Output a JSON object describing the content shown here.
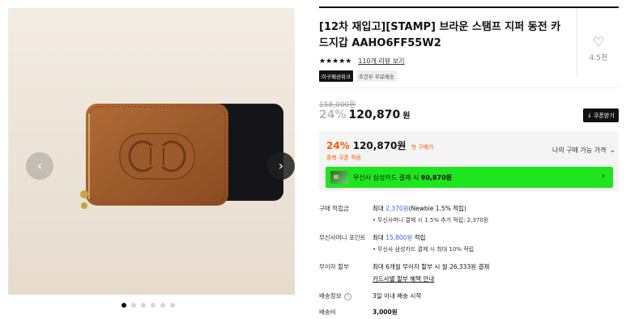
{
  "gallery": {
    "prev_icon": "chevron-left-icon",
    "next_icon": "chevron-right-icon",
    "prev_glyph": "‹",
    "next_glyph": "›",
    "slide_count": 6,
    "active_slide": 1
  },
  "product": {
    "title": "[12차 재입고][STAMP] 브라운 스탬프 지퍼 동전 카드지갑 AAHO6FF55W2",
    "stars": "★★★★★",
    "review_link": "110개 리뷰 보기",
    "badge_1": "이구패션위크",
    "badge_2": "조건부 무료배송"
  },
  "like": {
    "icon": "heart-icon",
    "glyph": "♡",
    "count": "4.5천"
  },
  "price": {
    "original": "158,000원",
    "discount": "24%",
    "sale": "120,870",
    "sale_unit": "원",
    "coupon_button": "쿠폰받기",
    "coupon_glyph": "↓"
  },
  "price_box": {
    "discount": "24%",
    "sale": "120,870원",
    "first_purchase": "첫 구매가",
    "coupon_note": "중복 쿠폰 적용",
    "my_price": "나의 구매 가능 가격",
    "my_price_glyph": "⌄",
    "card_text": "무신사 삼성카드 결제 시",
    "card_amount": "90,870원",
    "card_arrow": "›",
    "card_bar_color": "#1fe51f"
  },
  "details": {
    "points_label": "구매 적립금",
    "points_prefix": "최대 ",
    "points_value": "2,370원",
    "points_suffix": "(Newbie 1.5% 적립)",
    "points_sub": "무신사머니 결제 시 1.5% 추가 적립: 2,370원",
    "money_label": "무신사머니 포인트",
    "money_prefix": "최대 ",
    "money_value": "15,800원",
    "money_suffix": " 적립",
    "money_sub": "무신사 삼성카드 결제 시 최대 10% 적립",
    "installment_label": "무이자 할부",
    "installment_text": "최대 6개월 무이자 할부 시 월 26,333원 결제",
    "installment_link": "카드사별 할부 혜택 안내",
    "shipping_label": "배송정보",
    "shipping_help": "?",
    "shipping_text": "3일 이내 배송 시작",
    "fee_label": "배송비",
    "fee_value": "3,000원"
  }
}
